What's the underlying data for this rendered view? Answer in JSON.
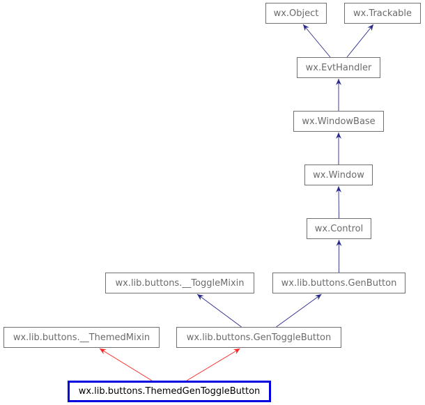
{
  "diagram": {
    "type": "class-inheritance",
    "focus_node": "wx.lib.buttons.ThemedGenToggleButton",
    "colors": {
      "edge_default": "#2a2a8a",
      "edge_focus": "#ff2020",
      "focus_border": "#0000e0",
      "node_border": "#6f6f6f",
      "node_text": "#6b6b6b",
      "focus_text": "#000000"
    },
    "nodes": [
      {
        "id": "object",
        "label": "wx.Object"
      },
      {
        "id": "trackable",
        "label": "wx.Trackable"
      },
      {
        "id": "evthandler",
        "label": "wx.EvtHandler"
      },
      {
        "id": "windowbase",
        "label": "wx.WindowBase"
      },
      {
        "id": "window",
        "label": "wx.Window"
      },
      {
        "id": "control",
        "label": "wx.Control"
      },
      {
        "id": "togglemixin",
        "label": "wx.lib.buttons.__ToggleMixin"
      },
      {
        "id": "genbutton",
        "label": "wx.lib.buttons.GenButton"
      },
      {
        "id": "themedmixin",
        "label": "wx.lib.buttons.__ThemedMixin"
      },
      {
        "id": "gentogglebutton",
        "label": "wx.lib.buttons.GenToggleButton"
      },
      {
        "id": "themedgentogglebutton",
        "label": "wx.lib.buttons.ThemedGenToggleButton"
      }
    ],
    "edges": [
      {
        "from": "evthandler",
        "to": "object",
        "kind": "default"
      },
      {
        "from": "evthandler",
        "to": "trackable",
        "kind": "default"
      },
      {
        "from": "windowbase",
        "to": "evthandler",
        "kind": "default"
      },
      {
        "from": "window",
        "to": "windowbase",
        "kind": "default"
      },
      {
        "from": "control",
        "to": "window",
        "kind": "default"
      },
      {
        "from": "genbutton",
        "to": "control",
        "kind": "default"
      },
      {
        "from": "gentogglebutton",
        "to": "togglemixin",
        "kind": "default"
      },
      {
        "from": "gentogglebutton",
        "to": "genbutton",
        "kind": "default"
      },
      {
        "from": "themedgentogglebutton",
        "to": "themedmixin",
        "kind": "focus"
      },
      {
        "from": "themedgentogglebutton",
        "to": "gentogglebutton",
        "kind": "focus"
      }
    ]
  }
}
